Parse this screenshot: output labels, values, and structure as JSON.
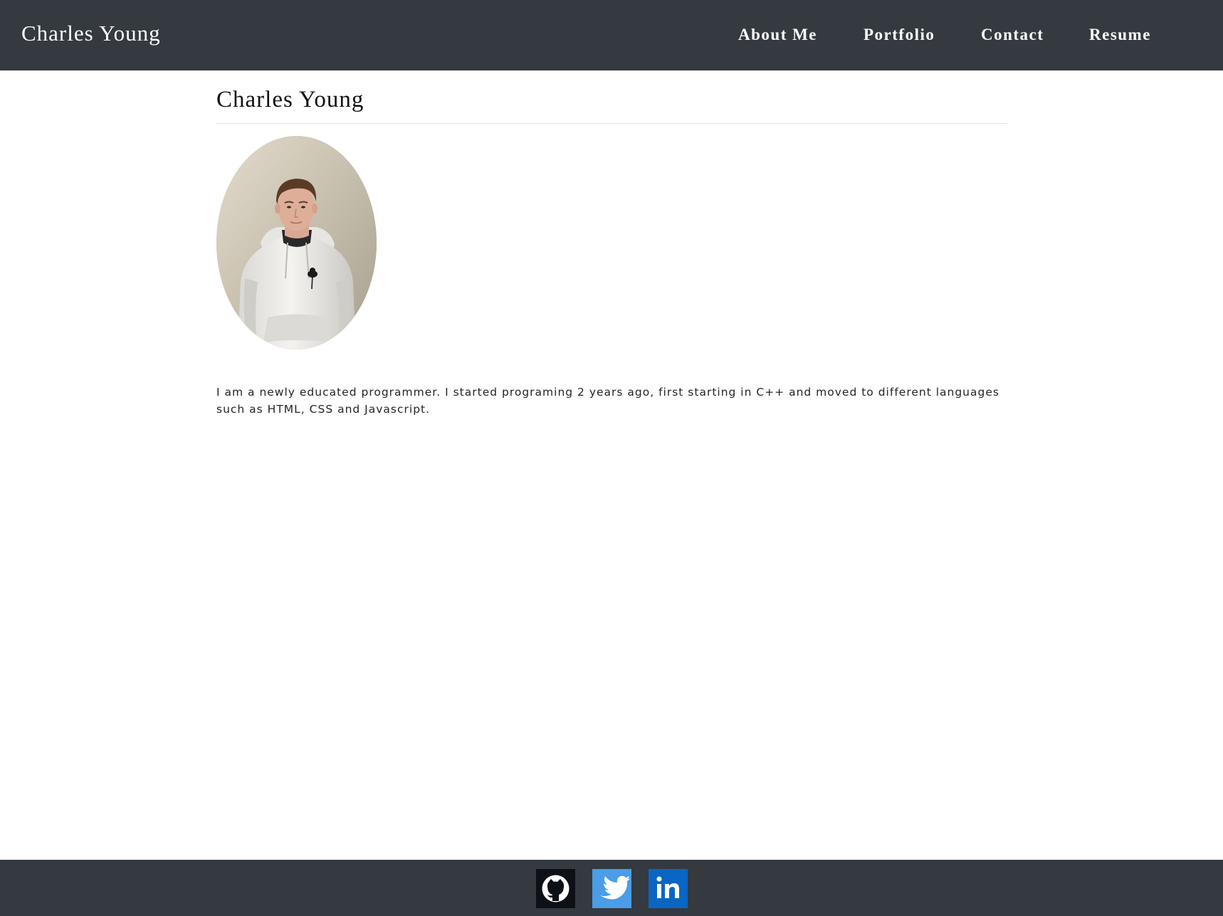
{
  "header": {
    "brand": "Charles Young",
    "nav": [
      {
        "label": "About Me"
      },
      {
        "label": "Portfolio"
      },
      {
        "label": "Contact"
      },
      {
        "label": "Resume"
      }
    ]
  },
  "main": {
    "title": "Charles Young",
    "bio": "I am a newly educated programmer. I started programing 2 years ago, first starting in C++ and moved to different languages such as HTML, CSS and Javascript."
  },
  "footer": {
    "social": [
      {
        "icon": "github-icon",
        "color": "#0d1117"
      },
      {
        "icon": "twitter-icon",
        "color": "#4a9de6"
      },
      {
        "icon": "linkedin-icon",
        "color": "#0a66c2"
      }
    ]
  },
  "colors": {
    "navbar": "#343a40",
    "footer": "#343a40",
    "text": "#212529"
  }
}
